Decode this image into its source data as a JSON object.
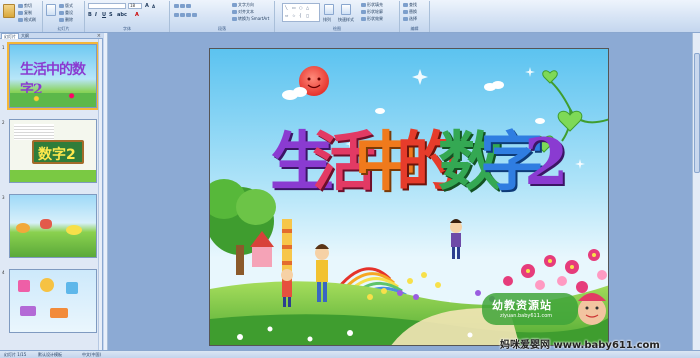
{
  "ribbon": {
    "groups": {
      "clipboard": "",
      "slides": "幻灯片",
      "font": "字体",
      "paragraph": "段落",
      "drawing": "绘图",
      "editing": "编辑"
    },
    "font_size": "18",
    "paragraph_items": [
      "文字方向",
      "对齐文本",
      "转换为 SmartArt"
    ],
    "drawing_items": [
      "排列",
      "快速样式"
    ],
    "drawing_right_items": [
      "形状填充",
      "形状轮廓",
      "形状效果"
    ],
    "editing_items": [
      "查找",
      "替换",
      "选择"
    ]
  },
  "left_panel": {
    "tabs": [
      "幻灯片",
      "大纲"
    ],
    "close": "×",
    "thumbnails": [
      {
        "num": "1",
        "title": "生活中的数字2"
      },
      {
        "num": "2",
        "title": "数字2"
      },
      {
        "num": "3",
        "title": ""
      },
      {
        "num": "4",
        "title": ""
      }
    ]
  },
  "slide": {
    "title_chars": [
      "生",
      "活",
      "中",
      "的",
      "数",
      "字",
      "2"
    ],
    "logo_text": "幼教资源站",
    "logo_url": "ziyuan.baby611.com"
  },
  "watermark": "妈咪爱婴网 www.baby611.com",
  "status_bar": {
    "slide_info": "幻灯片 1/15",
    "theme": "默认设计模板",
    "language": "中文(中国)"
  },
  "colors": {
    "ribbon_bg": "#d4e2f4",
    "slide_sky": "#7fd0f5",
    "grass": "#7ac943"
  }
}
